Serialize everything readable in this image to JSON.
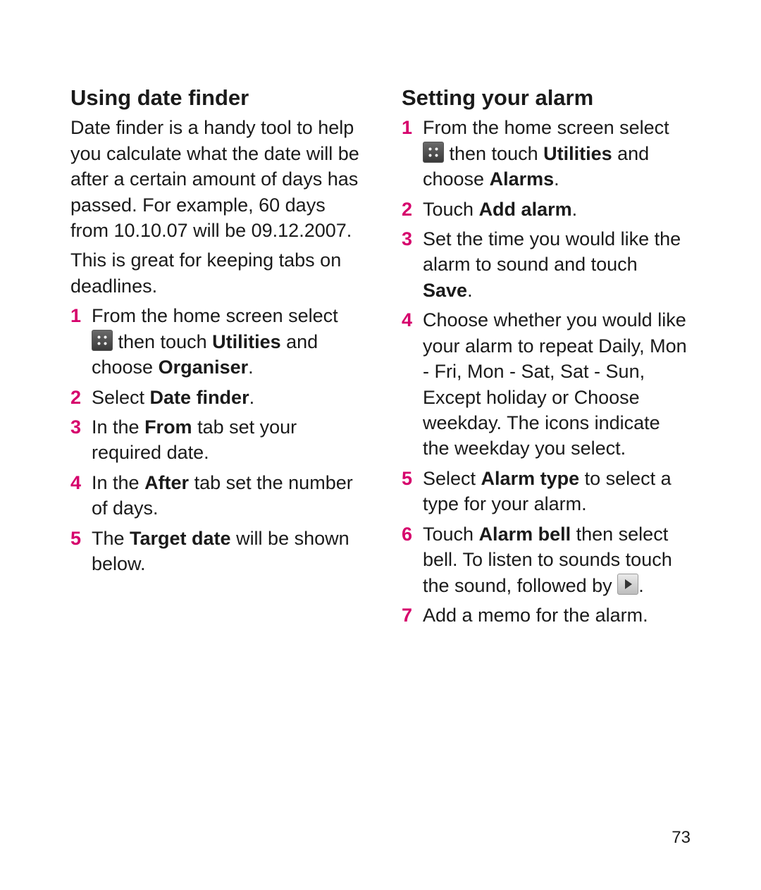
{
  "page_number": "73",
  "left": {
    "heading": "Using date finder",
    "intro": "Date finder is a handy tool to help you calculate what the date will be after a certain amount of days has passed. For example, 60 days from 10.10.07 will be 09.12.2007.",
    "intro2": "This is great for keeping tabs on deadlines.",
    "steps": {
      "s1_a": "From the home screen select ",
      "s1_b": " then touch ",
      "s1_utilities": "Utilities",
      "s1_c": " and choose ",
      "s1_organiser": "Organiser",
      "s1_d": ".",
      "s2_a": "Select ",
      "s2_b": "Date finder",
      "s2_c": ".",
      "s3_a": "In the ",
      "s3_b": "From",
      "s3_c": " tab set your required date.",
      "s4_a": "In the ",
      "s4_b": "After",
      "s4_c": " tab set the number of days.",
      "s5_a": "The ",
      "s5_b": "Target date",
      "s5_c": " will be shown below."
    }
  },
  "right": {
    "heading": "Setting your alarm",
    "steps": {
      "s1_a": "From the home screen select ",
      "s1_b": " then touch ",
      "s1_utilities": "Utilities",
      "s1_c": " and choose ",
      "s1_alarms": "Alarms",
      "s1_d": ".",
      "s2_a": "Touch ",
      "s2_b": "Add alarm",
      "s2_c": ".",
      "s3_a": "Set the time you would like the alarm to sound and touch ",
      "s3_b": "Save",
      "s3_c": ".",
      "s4": "Choose whether you would like your alarm to repeat Daily, Mon - Fri, Mon - Sat, Sat - Sun, Except holiday or Choose weekday. The icons indicate the weekday you select.",
      "s5_a": "Select ",
      "s5_b": "Alarm type",
      "s5_c": " to select a type for your alarm.",
      "s6_a": "Touch ",
      "s6_b": "Alarm bell",
      "s6_c": " then select bell. To listen to sounds touch the sound, followed by ",
      "s6_d": ".",
      "s7": "Add a memo for the alarm."
    }
  },
  "nums": {
    "n1": "1",
    "n2": "2",
    "n3": "3",
    "n4": "4",
    "n5": "5",
    "n6": "6",
    "n7": "7"
  }
}
